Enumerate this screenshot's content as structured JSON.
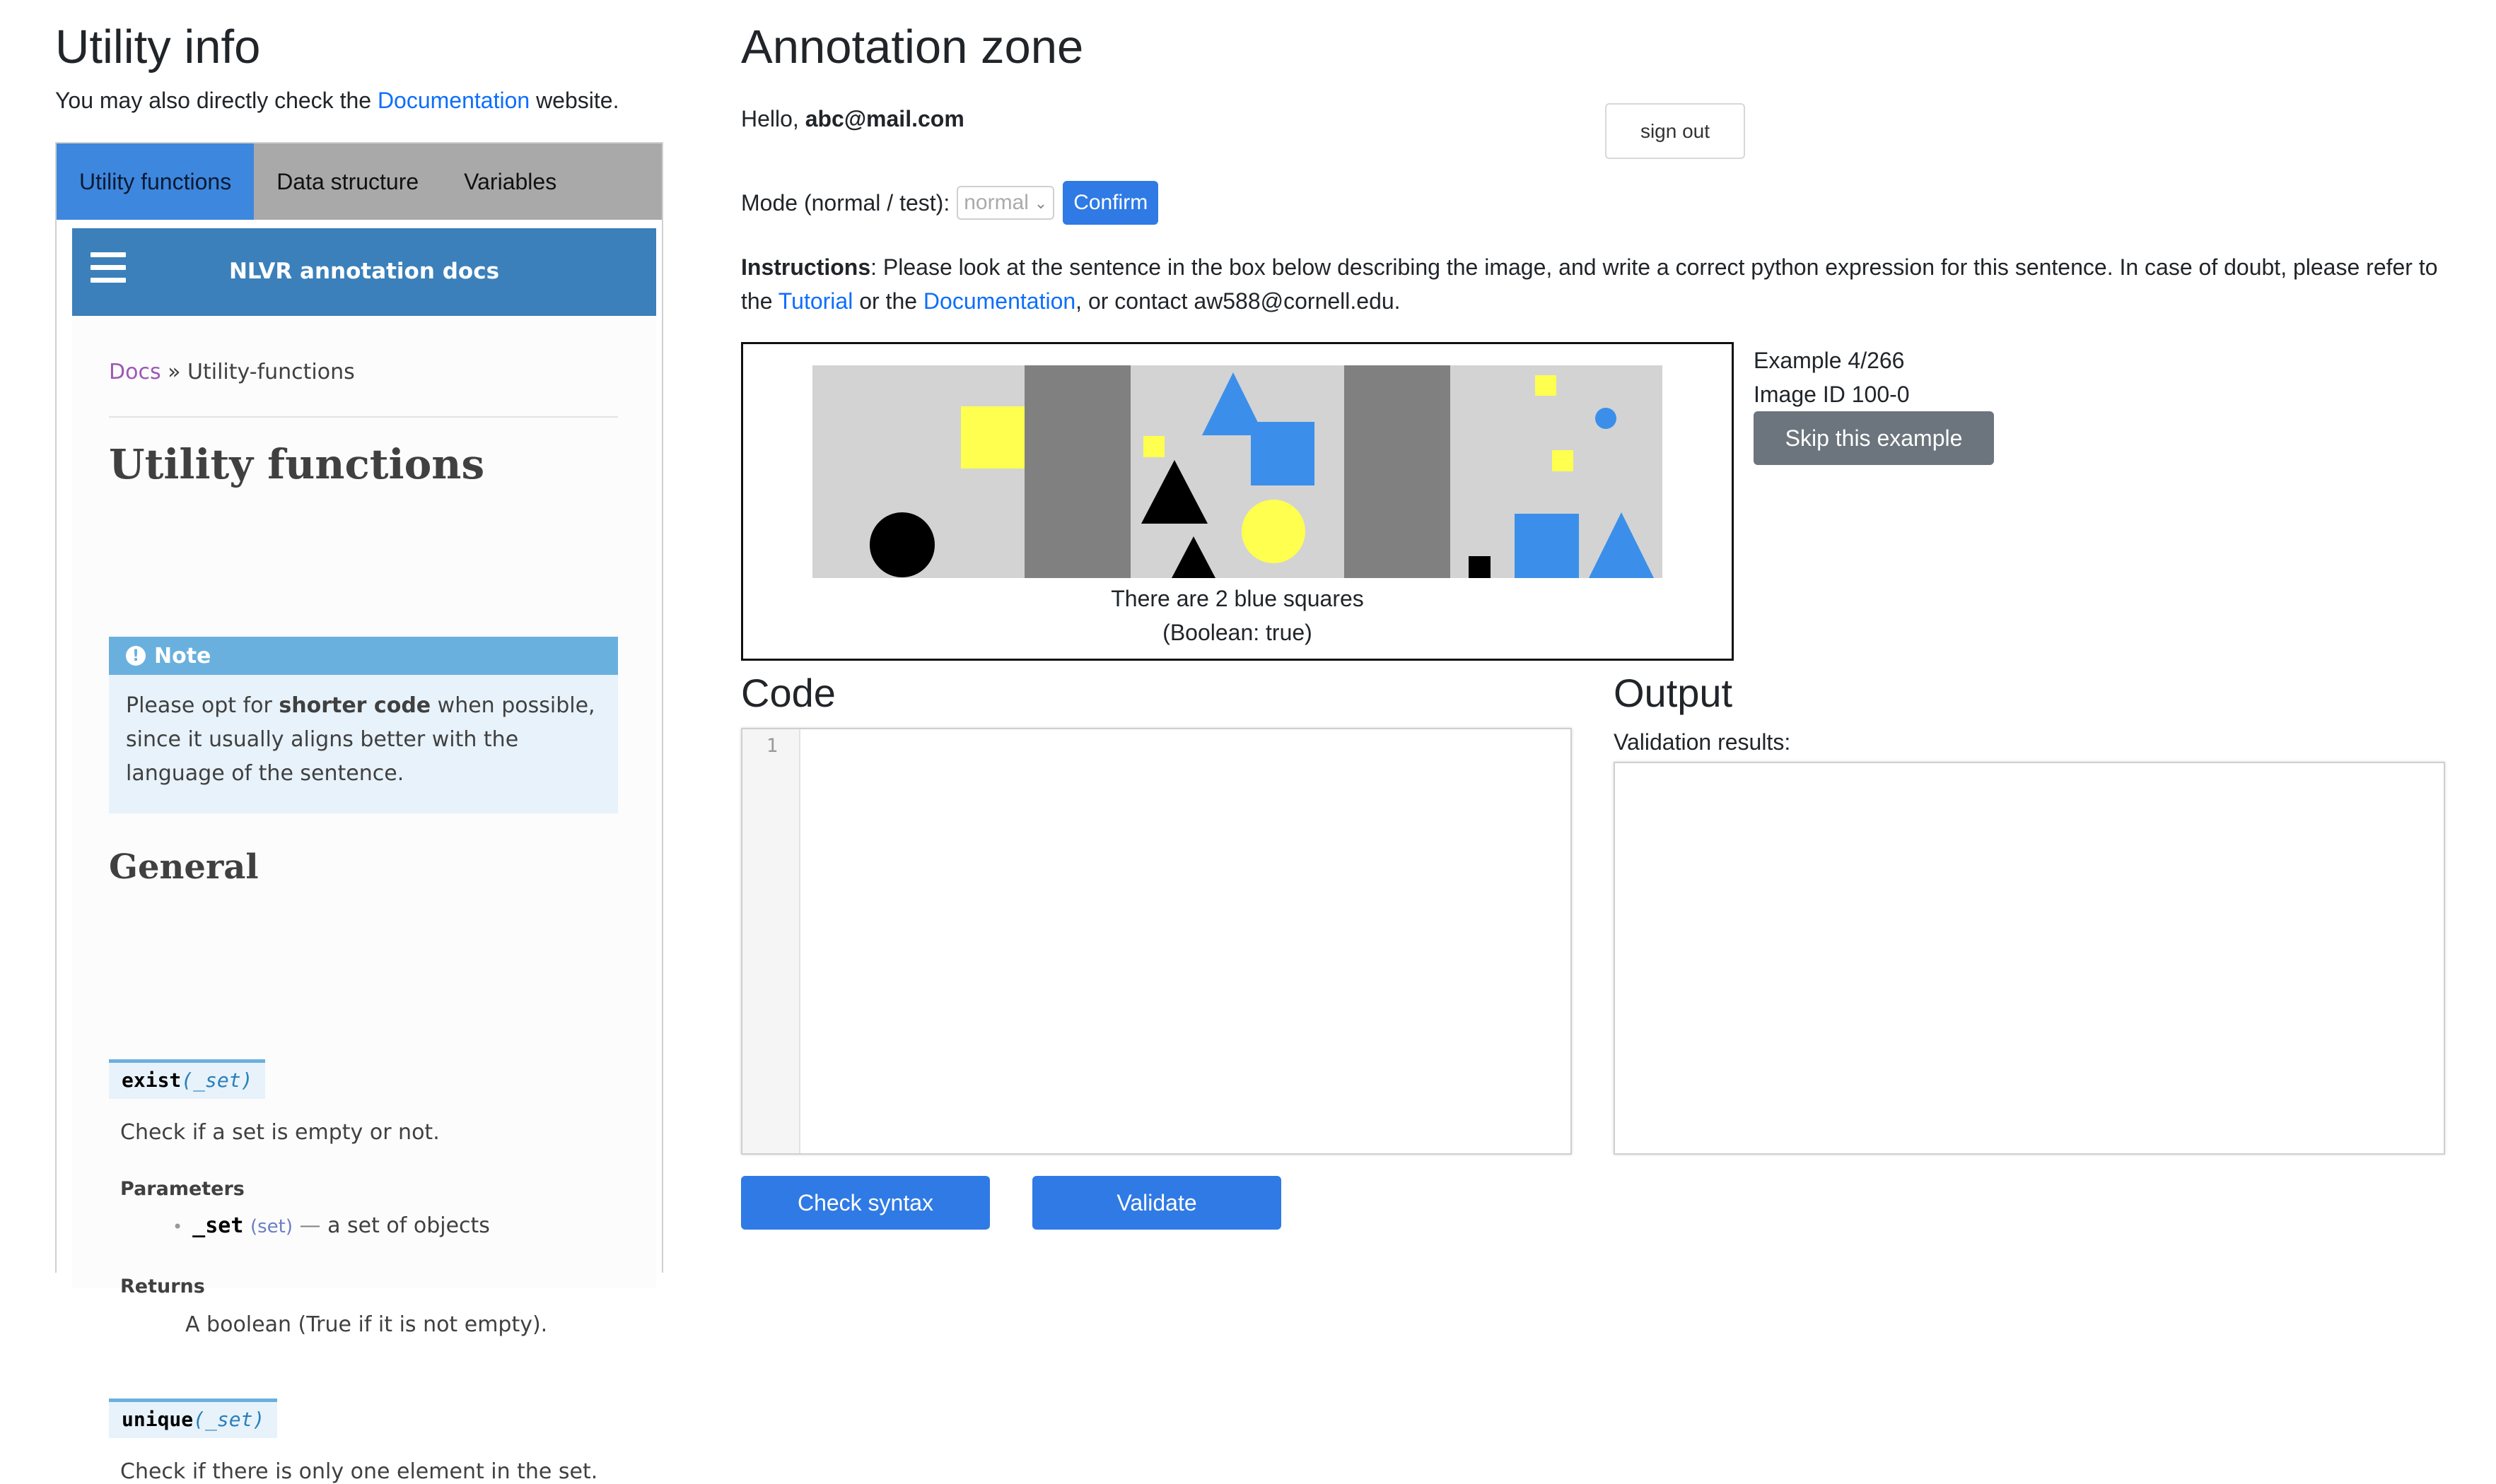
{
  "utility": {
    "title": "Utility info",
    "intro_prefix": "You may also directly check the ",
    "intro_link": "Documentation",
    "intro_suffix": " website.",
    "tabs": [
      "Utility functions",
      "Data structure",
      "Variables"
    ],
    "active_tab": "Utility functions"
  },
  "docs": {
    "header_title": "NLVR annotation docs",
    "breadcrumb_link": "Docs",
    "breadcrumb_current": "» Utility-functions",
    "heading": "Utility functions",
    "note": {
      "title": "Note",
      "body_pre": "Please opt for ",
      "body_bold": "shorter code",
      "body_post": " when possible, since it usually aligns better with the language of the sentence."
    },
    "section": "General",
    "functions": [
      {
        "name": "exist",
        "param_sig": "(_set)",
        "description": "Check if a set is empty or not.",
        "params_label": "Parameters",
        "param_name": "_set",
        "param_type": "(set)",
        "param_dash": "—",
        "param_desc": "a set of objects",
        "returns_label": "Returns",
        "returns_desc": "A boolean (True if it is not empty)."
      },
      {
        "name": "unique",
        "param_sig": "(_set)",
        "description": "Check if there is only one element in the set."
      }
    ]
  },
  "annotation": {
    "title": "Annotation zone",
    "hello_prefix": "Hello, ",
    "user_email": "abc@mail.com",
    "signout_label": "sign out",
    "mode_label": "Mode (normal / test):",
    "mode_value": "normal",
    "confirm_label": "Confirm",
    "instructions_label": "Instructions",
    "instructions_text_1": ": Please look at the sentence in the box below describing the image, and write a correct python expression for this sentence. In case of doubt, please refer to the ",
    "tutorial_link": "Tutorial",
    "instructions_text_2": " or the ",
    "documentation_link": "Documentation",
    "instructions_text_3": ", or contact aw588@cornell.edu.",
    "sentence": "There are 2 blue squares",
    "boolean_label": "(Boolean: true)",
    "example_counter": "Example 4/266",
    "image_id": "Image ID 100-0",
    "skip_label": "Skip this example",
    "code_title": "Code",
    "line_number": "1",
    "output_title": "Output",
    "validation_label": "Validation results:",
    "check_syntax_label": "Check syntax",
    "validate_label": "Validate"
  },
  "colors": {
    "primary_button": "#2f7ae5",
    "active_tab": "#3d87de",
    "docs_header": "#3b80ba",
    "skip_button": "#6c757d",
    "shape_blue": "#3b8fea",
    "shape_yellow": "#ffff4f",
    "shape_black": "#000000",
    "scene_bg": "#d3d3d3",
    "scene_divider": "#808080"
  },
  "icons": {
    "menu": "hamburger-icon",
    "note": "exclamation-circle-icon",
    "select": "chevron-down-icon"
  }
}
